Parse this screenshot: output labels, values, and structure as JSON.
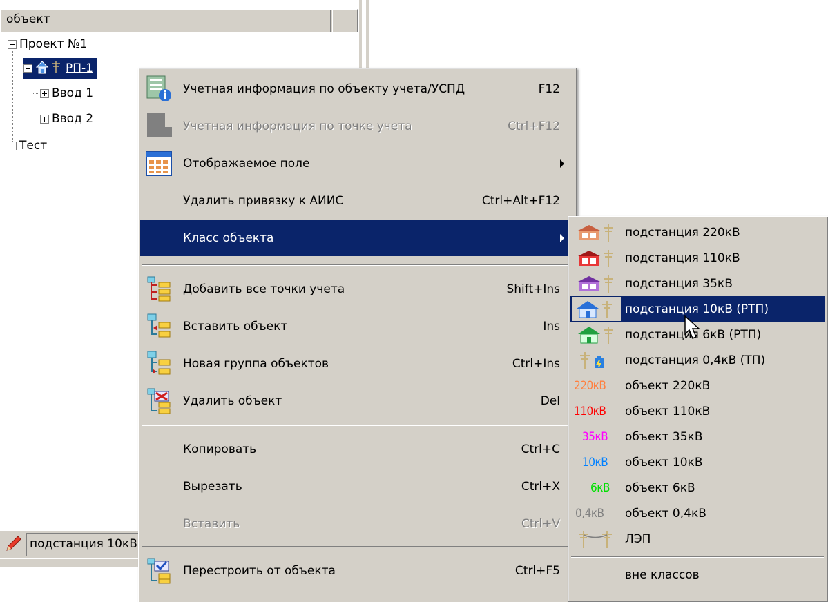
{
  "tree": {
    "column_header": "объект",
    "nodes": [
      {
        "label": "Проект №1"
      },
      {
        "label": "РП-1"
      },
      {
        "label": "Ввод 1"
      },
      {
        "label": "Ввод 2"
      },
      {
        "label": "Тест"
      }
    ],
    "status_text": "подстанция 10кВ (РТП)"
  },
  "context_menu": {
    "items": [
      {
        "label": "Учетная информация по объекту учета/УСПД",
        "shortcut": "F12",
        "icon": "info-card-icon",
        "enabled": true
      },
      {
        "label": "Учетная информация по точке учета",
        "shortcut": "Ctrl+F12",
        "icon": "info-card-disabled-icon",
        "enabled": false
      },
      {
        "label": "Отображаемое поле",
        "shortcut": "",
        "icon": "grid-table-icon",
        "enabled": true,
        "submenu": true
      },
      {
        "label": "Удалить привязку к АИИС",
        "shortcut": "Ctrl+Alt+F12",
        "enabled": true
      },
      {
        "label": "Класс объекта",
        "shortcut": "",
        "enabled": true,
        "submenu": true,
        "highlighted": true
      },
      {
        "label": "Добавить все точки учета",
        "shortcut": "Shift+Ins",
        "icon": "add-all-points-icon",
        "enabled": true
      },
      {
        "label": "Вставить объект",
        "shortcut": "Ins",
        "icon": "insert-object-icon",
        "enabled": true
      },
      {
        "label": "Новая группа объектов",
        "shortcut": "Ctrl+Ins",
        "icon": "new-group-icon",
        "enabled": true
      },
      {
        "label": "Удалить объект",
        "shortcut": "Del",
        "icon": "delete-object-icon",
        "enabled": true
      },
      {
        "label": "Копировать",
        "shortcut": "Ctrl+C",
        "enabled": true
      },
      {
        "label": "Вырезать",
        "shortcut": "Ctrl+X",
        "enabled": true
      },
      {
        "label": "Вставить",
        "shortcut": "Ctrl+V",
        "enabled": false
      },
      {
        "label": "Перестроить от объекта",
        "shortcut": "Ctrl+F5",
        "icon": "rebuild-icon",
        "enabled": true
      }
    ]
  },
  "submenu": {
    "items": [
      {
        "label": "подстанция 220кВ",
        "icon": "substation-220-icon"
      },
      {
        "label": "подстанция 110кВ",
        "icon": "substation-110-icon"
      },
      {
        "label": "подстанция 35кВ",
        "icon": "substation-35-icon"
      },
      {
        "label": "подстанция 10кВ (РТП)",
        "icon": "substation-10-icon",
        "highlighted": true
      },
      {
        "label": "подстанция 6кВ (РТП)",
        "icon": "substation-6-icon"
      },
      {
        "label": "подстанция 0,4кВ (ТП)",
        "icon": "substation-04-icon"
      },
      {
        "label": "объект 220кВ",
        "badge": "220кВ",
        "badge_color": "#ff8040"
      },
      {
        "label": "объект 110кВ",
        "badge": "110кВ",
        "badge_color": "#ff0000"
      },
      {
        "label": "объект 35кВ",
        "badge": "35кВ",
        "badge_color": "#ff00ff"
      },
      {
        "label": "объект 10кВ",
        "badge": "10кВ",
        "badge_color": "#0080ff"
      },
      {
        "label": "объект 6кВ",
        "badge": "6кВ",
        "badge_color": "#00ff00"
      },
      {
        "label": "объект 0,4кВ",
        "badge": "0,4кВ",
        "badge_color": "#808080"
      },
      {
        "label": "ЛЭП",
        "icon": "power-line-icon"
      },
      {
        "label": "вне классов"
      }
    ]
  },
  "colors": {
    "selection": "#0a246a",
    "menu_bg": "#d4d0c8"
  }
}
